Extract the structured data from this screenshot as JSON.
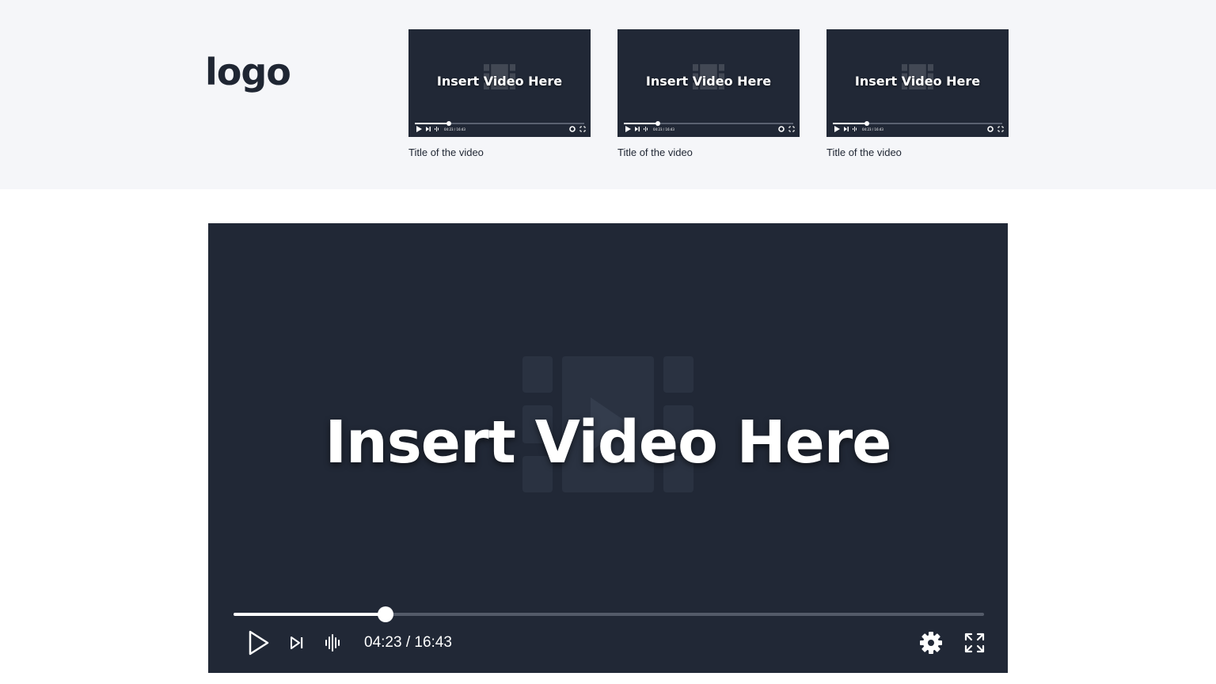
{
  "header": {
    "logo": "logo"
  },
  "thumbnails": [
    {
      "placeholder": "Insert Video Here",
      "title": "Title of the video",
      "progress_percent": 20,
      "time": "04:23 / 16:43"
    },
    {
      "placeholder": "Insert Video Here",
      "title": "Title of the video",
      "progress_percent": 20,
      "time": "04:23 / 16:43"
    },
    {
      "placeholder": "Insert Video Here",
      "title": "Title of the video",
      "progress_percent": 20,
      "time": "04:23 / 16:43"
    }
  ],
  "player": {
    "placeholder": "Insert Video Here",
    "current_time": "04:23",
    "separator": " / ",
    "duration": "16:43",
    "progress_percent": 20.3,
    "icons": {
      "play": "play-icon",
      "next": "skip-next-icon",
      "audio": "audio-waveform-icon",
      "settings": "gear-icon",
      "fullscreen": "fullscreen-icon"
    }
  },
  "colors": {
    "header_bg": "#f5f6f9",
    "player_bg": "#212836",
    "text_dark": "#1f2633",
    "accent": "#ffffff"
  }
}
